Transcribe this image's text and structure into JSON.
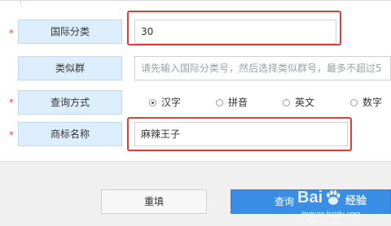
{
  "form": {
    "required_mark": "*",
    "rows": [
      {
        "label": "国际分类",
        "value": "30",
        "placeholder": ""
      },
      {
        "label": "类似群",
        "value": "",
        "placeholder": "请先输入国际分类号，然后选择类似群号，最多不超过5"
      },
      {
        "label": "查询方式"
      },
      {
        "label": "商标名称",
        "value": "麻辣王子",
        "placeholder": ""
      }
    ],
    "query_options": [
      {
        "label": "汉字",
        "checked": true
      },
      {
        "label": "拼音",
        "checked": false
      },
      {
        "label": "英文",
        "checked": false
      },
      {
        "label": "数字",
        "checked": false
      }
    ]
  },
  "buttons": {
    "reset_label": "重填",
    "query_label": "查询"
  },
  "watermark": {
    "brand": "Bai",
    "suffix": "经验",
    "url": "jingyan.baidu.com"
  },
  "colors": {
    "label_bg": "#dceefc",
    "required": "#e24a4a",
    "highlight": "#e23b3b",
    "primary_button": "#3a8ee6"
  }
}
